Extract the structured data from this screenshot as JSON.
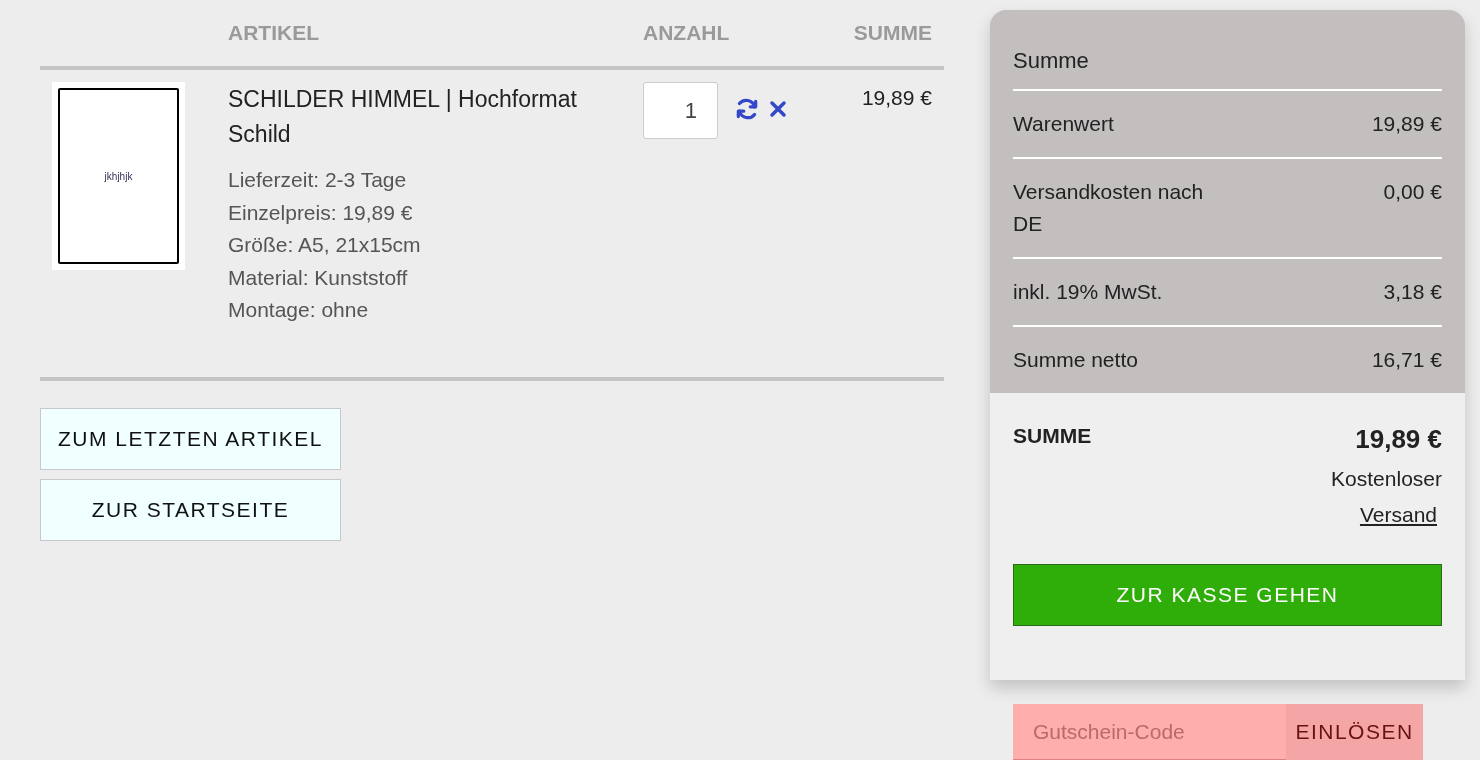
{
  "cart": {
    "columns": [
      {
        "label": "ARTIKEL"
      },
      {
        "label": "ANZAHL"
      },
      {
        "label": "SUMME"
      }
    ],
    "items": [
      {
        "preview_text": "jkhjhjk",
        "title": "SCHILDER HIMMEL | Hochformat Schild",
        "details": [
          "Lieferzeit: 2-3 Tage",
          "Einzelpreis: 19,89 €",
          "Größe: A5, 21x15cm",
          "Material: Kunststoff",
          "Montage: ohne"
        ],
        "quantity": "1",
        "sum": "19,89 €"
      }
    ],
    "buttons": [
      "ZUM LETZTEN ARTIKEL",
      "ZUR STARTSEITE"
    ]
  },
  "summary": {
    "title": "Summe",
    "rows": [
      {
        "label": "Warenwert",
        "value": "19,89 €"
      },
      {
        "label": "Versandkosten nach DE",
        "value": "0,00 €"
      },
      {
        "label": "inkl. 19% MwSt.",
        "value": "3,18 €"
      },
      {
        "label": "Summe netto",
        "value": "16,71 €"
      }
    ],
    "total_label": "SUMME",
    "total_value": "19,89 €",
    "shipping_note": "Kostenloser",
    "shipping_link": "Versand",
    "checkout": "ZUR KASSE GEHEN"
  },
  "coupon": {
    "placeholder": "Gutschein-Code",
    "button": "EINLÖSEN"
  }
}
